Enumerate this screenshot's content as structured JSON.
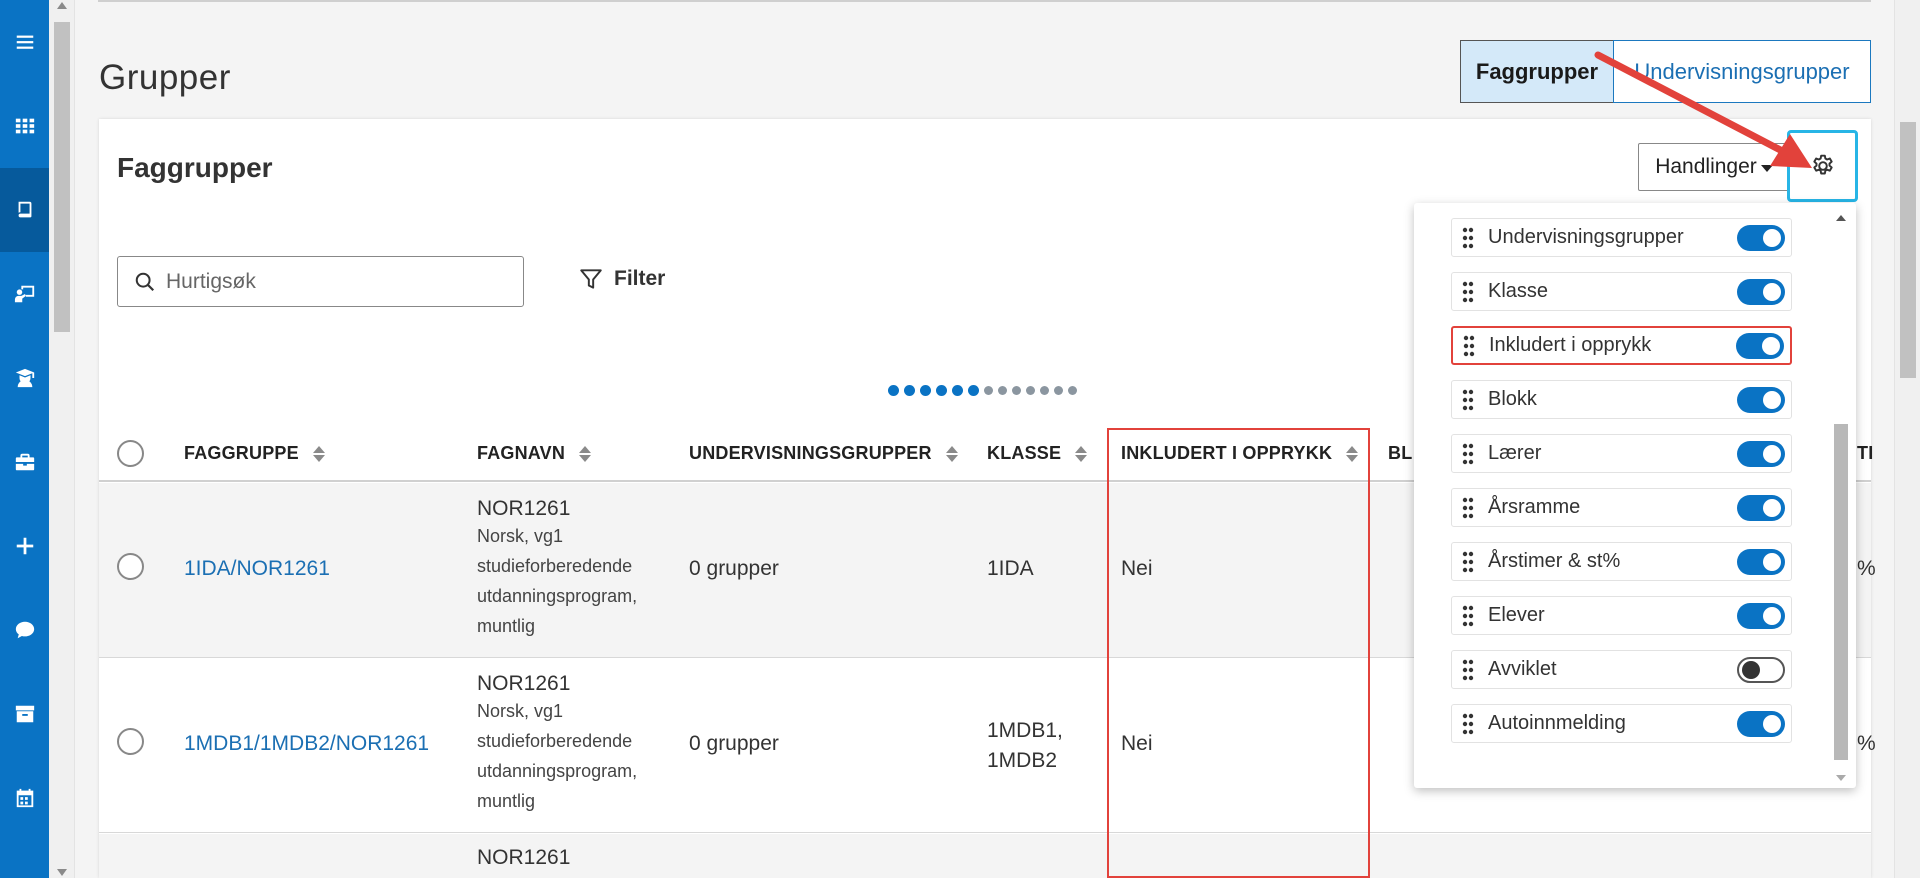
{
  "sidebar": {
    "items": [
      {
        "icon": "menu-icon"
      },
      {
        "icon": "grid-icon"
      },
      {
        "icon": "book-icon",
        "active": true
      },
      {
        "icon": "teacher-board-icon"
      },
      {
        "icon": "student-icon"
      },
      {
        "icon": "briefcase-icon"
      },
      {
        "icon": "plus-icon"
      },
      {
        "icon": "chat-icon"
      },
      {
        "icon": "archive-icon"
      },
      {
        "icon": "calendar-icon"
      }
    ]
  },
  "header": {
    "title": "Grupper",
    "segments": [
      {
        "label": "Faggrupper",
        "selected": true
      },
      {
        "label": "Undervisningsgrupper",
        "selected": false
      }
    ]
  },
  "card": {
    "title": "Faggrupper",
    "actions_label": "Handlinger",
    "search_placeholder": "Hurtigsøk",
    "filter_label": "Filter",
    "pager_dots": {
      "active": 6,
      "total": 13
    }
  },
  "table": {
    "columns": [
      "FAGGRUPPE",
      "FAGNAVN",
      "UNDERVISNINGSGRUPPER",
      "KLASSE",
      "INKLUDERT I OPPRYKK",
      "BL",
      "TI"
    ],
    "rows": [
      {
        "faggruppe": "1IDA/NOR1261",
        "fagnavn_code": "NOR1261",
        "fagnavn_desc": [
          "Norsk, vg1",
          "studieforberedende",
          "utdanningsprogram,",
          "muntlig"
        ],
        "undervisningsgrupper": "0 grupper",
        "klasse": [
          "1IDA"
        ],
        "inkludert": "Nei",
        "tail": "%"
      },
      {
        "faggruppe": "1MDB1/1MDB2/NOR1261",
        "fagnavn_code": "NOR1261",
        "fagnavn_desc": [
          "Norsk, vg1",
          "studieforberedende",
          "utdanningsprogram,",
          "muntlig"
        ],
        "undervisningsgrupper": "0 grupper",
        "klasse": [
          "1MDB1,",
          "1MDB2"
        ],
        "inkludert": "Nei",
        "tail": "%"
      },
      {
        "faggruppe": "",
        "fagnavn_code": "NOR1261",
        "fagnavn_desc": [],
        "undervisningsgrupper": "",
        "klasse": [],
        "inkludert": "",
        "tail": ""
      }
    ]
  },
  "column_settings": {
    "items": [
      {
        "label": "Undervisningsgrupper",
        "enabled": true
      },
      {
        "label": "Klasse",
        "enabled": true
      },
      {
        "label": "Inkludert i opprykk",
        "enabled": true,
        "highlighted": true
      },
      {
        "label": "Blokk",
        "enabled": true
      },
      {
        "label": "Lærer",
        "enabled": true
      },
      {
        "label": "Årsramme",
        "enabled": true
      },
      {
        "label": "Årstimer & st%",
        "enabled": true
      },
      {
        "label": "Elever",
        "enabled": true
      },
      {
        "label": "Avviklet",
        "enabled": false
      },
      {
        "label": "Autoinnmelding",
        "enabled": true
      }
    ]
  },
  "colors": {
    "brand": "#0a73c4",
    "link": "#1b6fb3",
    "annotation": "#e2423b",
    "gear_focus": "#27b5e6"
  }
}
